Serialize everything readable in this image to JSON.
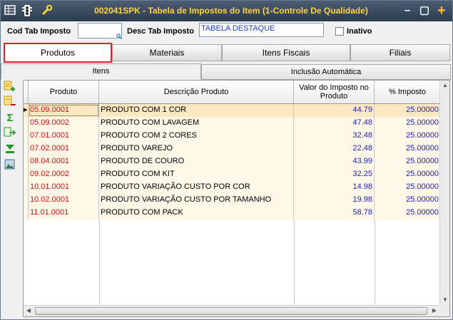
{
  "window": {
    "title": "002041SPK - Tabela de Impostos do Item (1-Controle De Qualidade)",
    "icons": [
      "grid-icon",
      "traffic-light-icon",
      "wrench-icon"
    ],
    "minimize_label": "–",
    "maximize_label": "▢",
    "add_label": "+"
  },
  "form": {
    "cod_label": "Cod Tab Imposto",
    "cod_value": "",
    "desc_label": "Desc Tab Imposto",
    "desc_value": "TABELA DESTAQUE",
    "inativo_label": "Inativo",
    "inativo_checked": false
  },
  "tabs": [
    {
      "label": "Produtos",
      "active": true
    },
    {
      "label": "Materiais",
      "active": false
    },
    {
      "label": "Itens Fiscais",
      "active": false
    },
    {
      "label": "Filiais",
      "active": false
    }
  ],
  "subtabs": [
    {
      "label": "Itens",
      "active": true
    },
    {
      "label": "Inclusão Automática",
      "active": false
    }
  ],
  "toolbar": [
    "add-row-icon",
    "remove-row-icon",
    "sum-icon",
    "export-icon",
    "filter-down-icon",
    "image-icon"
  ],
  "grid": {
    "headers": [
      "Produto",
      "Descrição Produto",
      "Valor do Imposto no Produto",
      "% Imposto"
    ],
    "rows": [
      {
        "produto": "05.09.0001",
        "descricao": "PRODUTO COM 1 COR",
        "valor": "44.79",
        "percent": "25.00000"
      },
      {
        "produto": "05.09.0002",
        "descricao": "PRODUTO COM LAVAGEM",
        "valor": "47.48",
        "percent": "25.00000"
      },
      {
        "produto": "07.01.0001",
        "descricao": "PRODUTO COM 2 CORES",
        "valor": "32.48",
        "percent": "25.00000"
      },
      {
        "produto": "07.02.0001",
        "descricao": "PRODUTO VAREJO",
        "valor": "22.48",
        "percent": "25.00000"
      },
      {
        "produto": "08.04.0001",
        "descricao": "PRODUTO DE COURO",
        "valor": "43.99",
        "percent": "25.00000"
      },
      {
        "produto": "09.02.0002",
        "descricao": "PRODUTO COM KIT",
        "valor": "32.25",
        "percent": "25.00000"
      },
      {
        "produto": "10.01.0001",
        "descricao": "PRODUTO VARIAÇÃO CUSTO POR COR",
        "valor": "14.98",
        "percent": "25.00000"
      },
      {
        "produto": "10.02.0001",
        "descricao": "PRODUTO VARIAÇÃO CUSTO POR TAMANHO",
        "valor": "19.98",
        "percent": "25.00000"
      },
      {
        "produto": "11.01.0001",
        "descricao": "PRODUTO COM PACK",
        "valor": "58.78",
        "percent": "25.00000"
      }
    ],
    "selected_row": 0,
    "row_indicator": "▸"
  },
  "colors": {
    "title_text": "#ffd23c",
    "selected_row": "#fde8c4",
    "row_bg": "#fdf8e8",
    "code_text": "#d01010",
    "value_text": "#2020c0",
    "active_tab_border": "#e0202a"
  }
}
